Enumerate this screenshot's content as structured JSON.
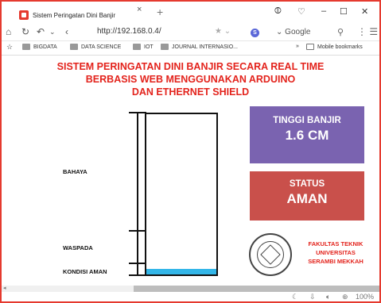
{
  "browser": {
    "tab_title": "Sistem Peringatan Dini Banjir",
    "tab_close": "×",
    "new_tab": "+",
    "url": "http://192.168.0.4/",
    "search_engine": "Google",
    "zoom": "100%",
    "bookmarks": [
      "BIGDATA",
      "DATA SCIENCE",
      "IOT",
      "JOURNAL INTERNASIO...",
      "Mobile bookmarks"
    ],
    "bookmarks_more": "»"
  },
  "page": {
    "title_line1": "SISTEM PERINGATAN DINI BANJIR SECARA REAL TIME",
    "title_line2": "BERBASIS WEB MENGGUNAKAN ARDUINO",
    "title_line3": "DAN ETHERNET SHIELD",
    "levels": {
      "bahaya": "BAHAYA",
      "waspada": "WASPADA",
      "kondisi_aman": "KONDISI AMAN"
    },
    "water_level_fraction": 0.035,
    "tinggi_label": "TINGGI BANJIR",
    "tinggi_value": "1.6 CM",
    "status_label": "STATUS",
    "status_value": "AMAN",
    "faculty_line1": "FAKULTAS TEKNIK",
    "faculty_line2": "UNIVERSITAS",
    "faculty_line3": "SERAMBI MEKKAH",
    "colors": {
      "title": "#e3231c",
      "tinggi_card": "#7a63b0",
      "status_card": "#c9504b",
      "water": "#33b6e8"
    }
  }
}
